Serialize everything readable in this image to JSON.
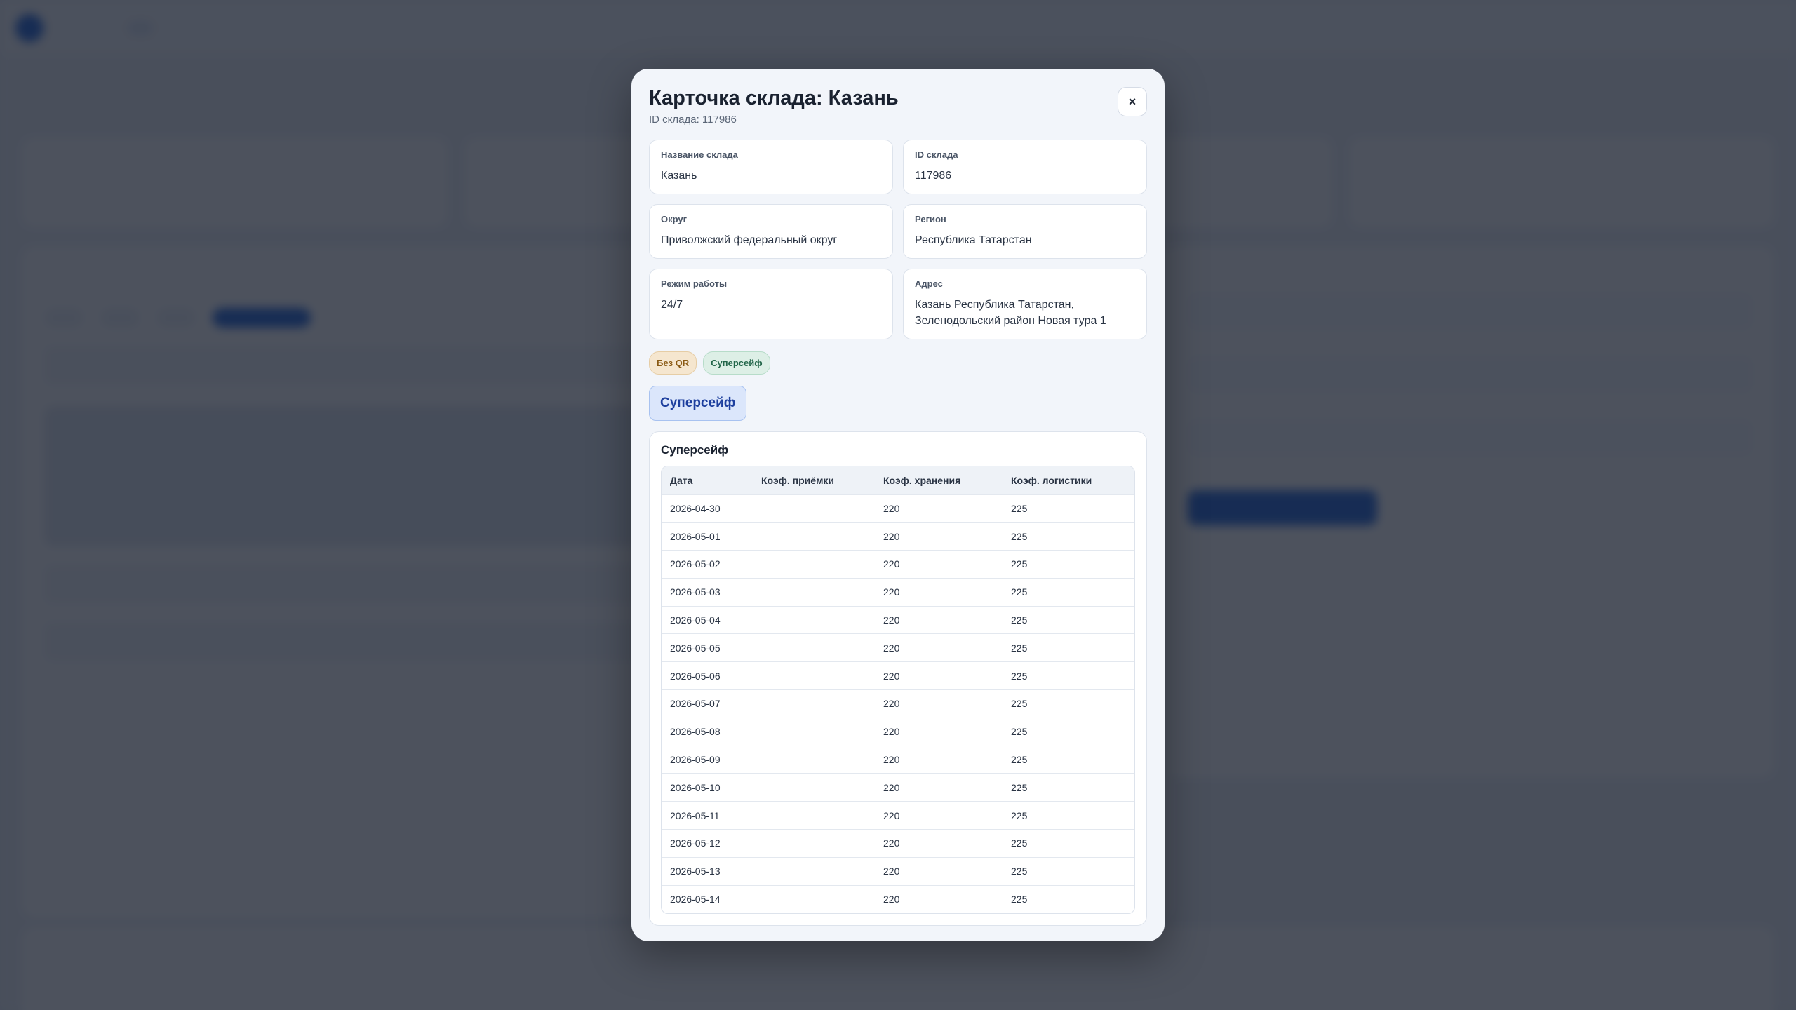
{
  "modal": {
    "title": "Карточка склада: Казань",
    "subtitle": "ID склада: 117986",
    "close_label": "×",
    "fields": {
      "name": {
        "label": "Название склада",
        "value": "Казань"
      },
      "id": {
        "label": "ID склада",
        "value": "117986"
      },
      "district": {
        "label": "Округ",
        "value": "Приволжский федеральный округ"
      },
      "region": {
        "label": "Регион",
        "value": "Республика Татарстан"
      },
      "schedule": {
        "label": "Режим работы",
        "value": "24/7"
      },
      "address": {
        "label": "Адрес",
        "value": "Казань Республика Татарстан, Зеленодольский район Новая тура 1"
      }
    },
    "badges": {
      "no_qr": "Без QR",
      "supersafe": "Суперсейф"
    },
    "tab_label": "Суперсейф",
    "table": {
      "title": "Суперсейф",
      "headers": [
        "Дата",
        "Коэф. приёмки",
        "Коэф. хранения",
        "Коэф. логистики"
      ],
      "rows": [
        [
          "2026-04-30",
          "",
          "220",
          "225"
        ],
        [
          "2026-05-01",
          "",
          "220",
          "225"
        ],
        [
          "2026-05-02",
          "",
          "220",
          "225"
        ],
        [
          "2026-05-03",
          "",
          "220",
          "225"
        ],
        [
          "2026-05-04",
          "",
          "220",
          "225"
        ],
        [
          "2026-05-05",
          "",
          "220",
          "225"
        ],
        [
          "2026-05-06",
          "",
          "220",
          "225"
        ],
        [
          "2026-05-07",
          "",
          "220",
          "225"
        ],
        [
          "2026-05-08",
          "",
          "220",
          "225"
        ],
        [
          "2026-05-09",
          "",
          "220",
          "225"
        ],
        [
          "2026-05-10",
          "",
          "220",
          "225"
        ],
        [
          "2026-05-11",
          "",
          "220",
          "225"
        ],
        [
          "2026-05-12",
          "",
          "220",
          "225"
        ],
        [
          "2026-05-13",
          "",
          "220",
          "225"
        ],
        [
          "2026-05-14",
          "",
          "220",
          "225"
        ]
      ]
    }
  },
  "colors": {
    "accent": "#1f63d8",
    "overlay": "#151c2a",
    "badge_orange": "#f5e6cf",
    "badge_green": "#ddefe6"
  }
}
